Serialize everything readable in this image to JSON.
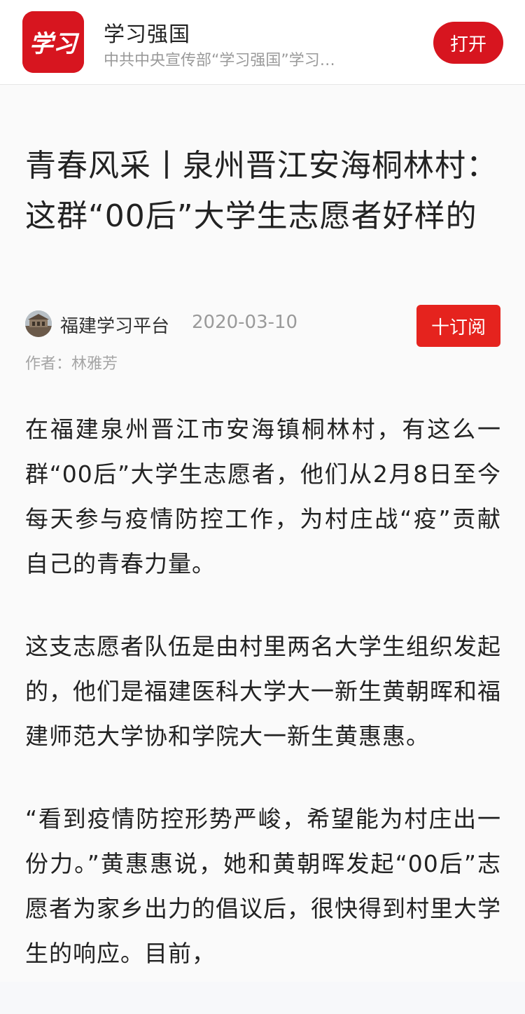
{
  "banner": {
    "app_name": "学习强国",
    "app_description": "中共中央宣传部“学习强国”学习…",
    "open_label": "打开",
    "logo_text": "学习",
    "brand_color": "#d7151f"
  },
  "article": {
    "title": "青春风采丨泉州晋江安海桐林村：这群“00后”大学生志愿者好样的",
    "source_name": "福建学习平台",
    "publish_date": "2020-03-10",
    "subscribe_label": "十订阅",
    "author_label": "作者：林雅芳",
    "paragraphs": [
      "在福建泉州晋江市安海镇桐林村，有这么一群“00后”大学生志愿者，他们从2月8日至今每天参与疫情防控工作，为村庄战“疫”贡献自己的青春力量。",
      "这支志愿者队伍是由村里两名大学生组织发起的，他们是福建医科大学大一新生黄朝晖和福建师范大学协和学院大一新生黄惠惠。",
      "“看到疫情防控形势严峻，希望能为村庄出一份力。”黄惠惠说，她和黄朝晖发起“00后”志愿者为家乡出力的倡议后，很快得到村里大学生的响应。目前，"
    ]
  }
}
